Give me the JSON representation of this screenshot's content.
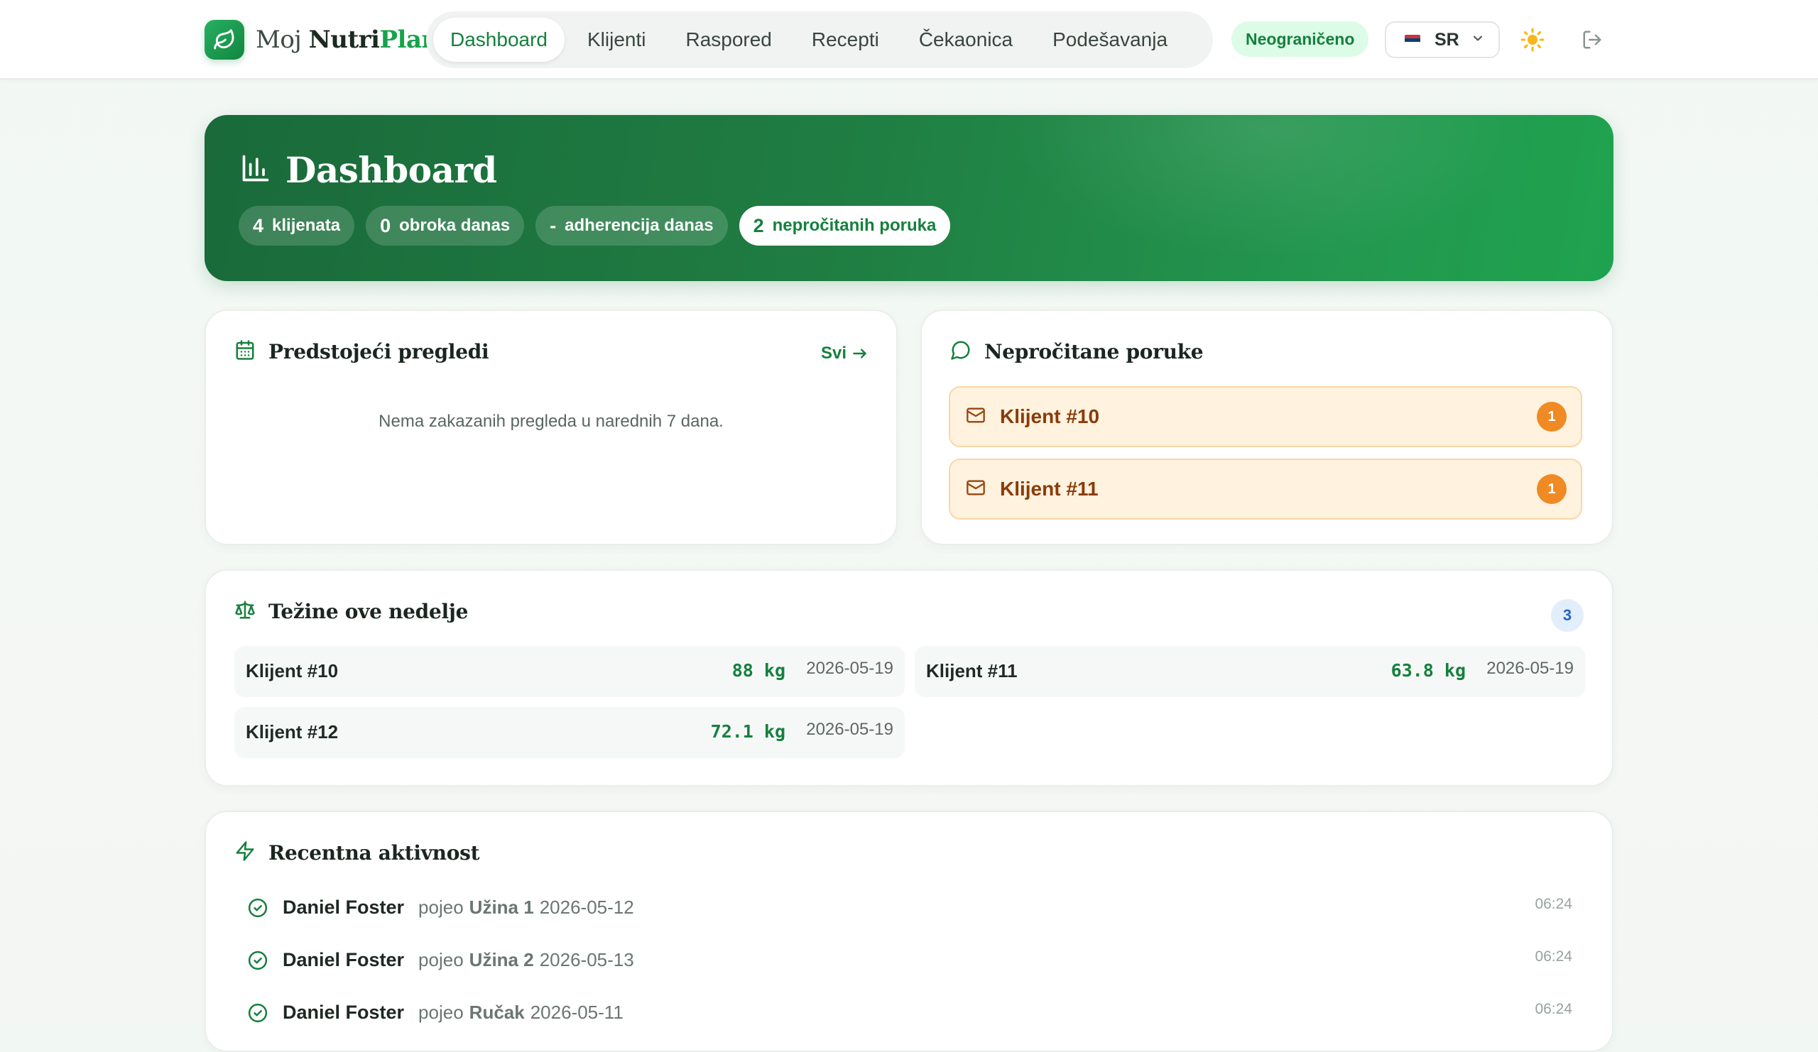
{
  "brand": {
    "moj": "Moj ",
    "nutri": "Nutri",
    "plan": "Plan"
  },
  "nav": {
    "items": [
      {
        "label": "Dashboard",
        "active": true
      },
      {
        "label": "Klijenti"
      },
      {
        "label": "Raspored"
      },
      {
        "label": "Recepti"
      },
      {
        "label": "Čekaonica"
      },
      {
        "label": "Podešavanja"
      }
    ],
    "plan_badge": "Neograničeno",
    "language": "SR",
    "icons": {
      "theme": "sun-icon",
      "logout": "logout-icon"
    }
  },
  "hero": {
    "title": "Dashboard",
    "stats": [
      {
        "num": "4",
        "label": "klijenata"
      },
      {
        "num": "0",
        "label": "obroka danas"
      },
      {
        "num": "-",
        "label": "adherencija danas"
      },
      {
        "num": "2",
        "label": "nepročitanih poruka"
      }
    ]
  },
  "appointments": {
    "title": "Predstojeći pregledi",
    "link": "Svi",
    "empty": "Nema zakazanih pregleda u narednih 7 dana."
  },
  "messages": {
    "title": "Nepročitane poruke",
    "items": [
      {
        "name": "Klijent #10",
        "count": "1"
      },
      {
        "name": "Klijent #11",
        "count": "1"
      }
    ]
  },
  "weights": {
    "title": "Težine ove nedelje",
    "count": "3",
    "rows": [
      {
        "name": "Klijent #10",
        "value": "88 kg",
        "date": "2026-05-19"
      },
      {
        "name": "Klijent #11",
        "value": "63.8 kg",
        "date": "2026-05-19"
      },
      {
        "name": "Klijent #12",
        "value": "72.1 kg",
        "date": "2026-05-19"
      }
    ]
  },
  "activity": {
    "title": "Recentna aktivnost",
    "items": [
      {
        "name": "Daniel Foster",
        "verb": "pojeo",
        "meal": "Užina 1",
        "date": "2026-05-12",
        "time": "06:24"
      },
      {
        "name": "Daniel Foster",
        "verb": "pojeo",
        "meal": "Užina 2",
        "date": "2026-05-13",
        "time": "06:24"
      },
      {
        "name": "Daniel Foster",
        "verb": "pojeo",
        "meal": "Ručak",
        "date": "2026-05-11",
        "time": "06:24"
      }
    ]
  },
  "colors": {
    "accent": "#16a34a",
    "hero_dark": "#1a6a3a",
    "warn_bg": "#fff2de",
    "warn_badge": "#f08a24"
  }
}
